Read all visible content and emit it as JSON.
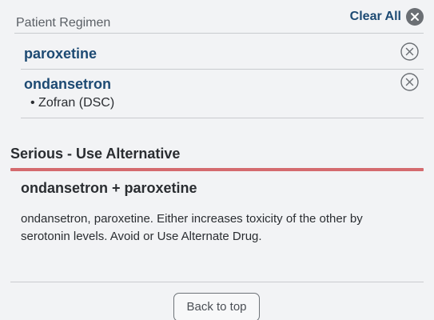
{
  "regimen": {
    "title": "Patient Regimen",
    "clear_all_label": "Clear All"
  },
  "drugs": [
    {
      "name": "paroxetine",
      "brand": ""
    },
    {
      "name": "ondansetron",
      "brand": "• Zofran (DSC)"
    }
  ],
  "interaction": {
    "severity": "Serious - Use Alternative",
    "severity_color": "#d46a6e",
    "title": "ondansetron + paroxetine",
    "description": "ondansetron, paroxetine. Either increases toxicity of the other by serotonin levels. Avoid or Use Alternate Drug."
  },
  "footer": {
    "back_to_top_label": "Back to top"
  },
  "colors": {
    "accent": "#1d4a73",
    "background": "#f2f3f5"
  },
  "icons": {
    "clear_all": "close-circle-filled-icon",
    "remove": "close-circle-outline-icon"
  }
}
